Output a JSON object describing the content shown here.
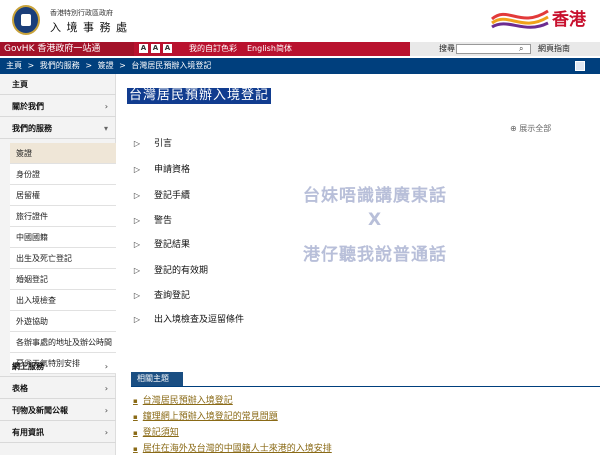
{
  "header": {
    "dept_small": "香港特別行政區政府",
    "dept_big": "入 境 事 務 處",
    "brand_text": "香港"
  },
  "topbar": {
    "govhk_label": "GovHK 香港政府一站通",
    "font_buttons": [
      "A",
      "A",
      "A"
    ],
    "color_label": "我的自訂色彩",
    "english_label": "English",
    "simp_label": "简体",
    "search_label": "搜尋",
    "web_guide_label": "網頁指南"
  },
  "breadcrumb": [
    "主頁",
    ">",
    "我們的服務",
    ">",
    "簽證",
    ">",
    "台灣居民預辦入境登記"
  ],
  "sidebar": {
    "top_items": [
      "主頁",
      "關於我們",
      "我們的服務"
    ],
    "sub_items": [
      "簽證",
      "身份證",
      "居留權",
      "旅行證件",
      "中國國籍",
      "出生及死亡登記",
      "婚姻登記",
      "出入境檢查",
      "外遊協助",
      "各辦事處的地址及辦公時間",
      "惡劣天氣特別安排"
    ],
    "bottom_items": [
      "網上服務",
      "表格",
      "刊物及新聞公報",
      "有用資訊"
    ]
  },
  "main": {
    "title": "台灣居民預辦入境登記",
    "expand_label": "展示全部",
    "items": [
      "引言",
      "申請資格",
      "登記手續",
      "警告",
      "登記結果",
      "登記的有效期",
      "查詢登記",
      "出入境檢查及逗留條件"
    ],
    "watermark": [
      "台妹唔識講廣東話",
      "X",
      "港仔聽我說普通話"
    ],
    "related_label": "相關主題",
    "related_links": [
      "台灣居民預辦入境登記",
      "鐘理網上預辦入境登記的常見問題",
      "登記須知",
      "居住在海外及台灣的中國籍人士來港的入境安排"
    ]
  }
}
